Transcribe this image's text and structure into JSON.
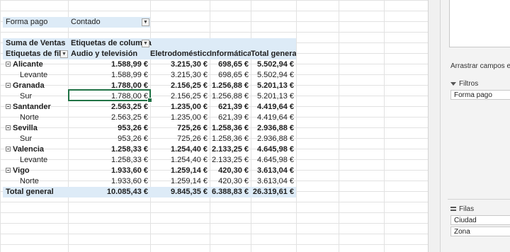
{
  "filter": {
    "label": "Forma pago",
    "value": "Contado"
  },
  "pivot": {
    "values_header": "Suma de Ventas",
    "column_labels_header": "Etiquetas de columna",
    "row_labels_header": "Etiquetas de fila",
    "columns": [
      "Audio y televisión",
      "Eletrodomésticos",
      "Informática",
      "Total general"
    ],
    "rows": [
      {
        "label": "Alicante",
        "level": 0,
        "values": [
          "1.588,99 €",
          "3.215,30 €",
          "698,65 €",
          "5.502,94 €"
        ]
      },
      {
        "label": "Levante",
        "level": 1,
        "values": [
          "1.588,99 €",
          "3.215,30 €",
          "698,65 €",
          "5.502,94 €"
        ]
      },
      {
        "label": "Granada",
        "level": 0,
        "values": [
          "1.788,00 €",
          "2.156,25 €",
          "1.256,88 €",
          "5.201,13 €"
        ]
      },
      {
        "label": "Sur",
        "level": 1,
        "values": [
          "1.788,00 €",
          "2.156,25 €",
          "1.256,88 €",
          "5.201,13 €"
        ]
      },
      {
        "label": "Santander",
        "level": 0,
        "values": [
          "2.563,25 €",
          "1.235,00 €",
          "621,39 €",
          "4.419,64 €"
        ]
      },
      {
        "label": "Norte",
        "level": 1,
        "values": [
          "2.563,25 €",
          "1.235,00 €",
          "621,39 €",
          "4.419,64 €"
        ]
      },
      {
        "label": "Sevilla",
        "level": 0,
        "values": [
          "953,26 €",
          "725,26 €",
          "1.258,36 €",
          "2.936,88 €"
        ]
      },
      {
        "label": "Sur",
        "level": 1,
        "values": [
          "953,26 €",
          "725,26 €",
          "1.258,36 €",
          "2.936,88 €"
        ]
      },
      {
        "label": "Valencia",
        "level": 0,
        "values": [
          "1.258,33 €",
          "1.254,40 €",
          "2.133,25 €",
          "4.645,98 €"
        ]
      },
      {
        "label": "Levante",
        "level": 1,
        "values": [
          "1.258,33 €",
          "1.254,40 €",
          "2.133,25 €",
          "4.645,98 €"
        ]
      },
      {
        "label": "Vigo",
        "level": 0,
        "values": [
          "1.933,60 €",
          "1.259,14 €",
          "420,30 €",
          "3.613,04 €"
        ]
      },
      {
        "label": "Norte",
        "level": 1,
        "values": [
          "1.933,60 €",
          "1.259,14 €",
          "420,30 €",
          "3.613,04 €"
        ]
      }
    ],
    "grand_total": {
      "label": "Total general",
      "values": [
        "10.085,43 €",
        "9.845,35 €",
        "6.388,83 €",
        "26.319,61 €"
      ]
    }
  },
  "pane": {
    "drag_hint": "Arrastrar campos entre las áreas siguientes:",
    "filters_label": "Filtros",
    "filters_fields": [
      "Forma pago"
    ],
    "rows_label": "Filas",
    "rows_fields": [
      "Ciudad",
      "Zona"
    ]
  },
  "colors": {
    "header_bg": "#ddebf7",
    "selection": "#217346"
  }
}
